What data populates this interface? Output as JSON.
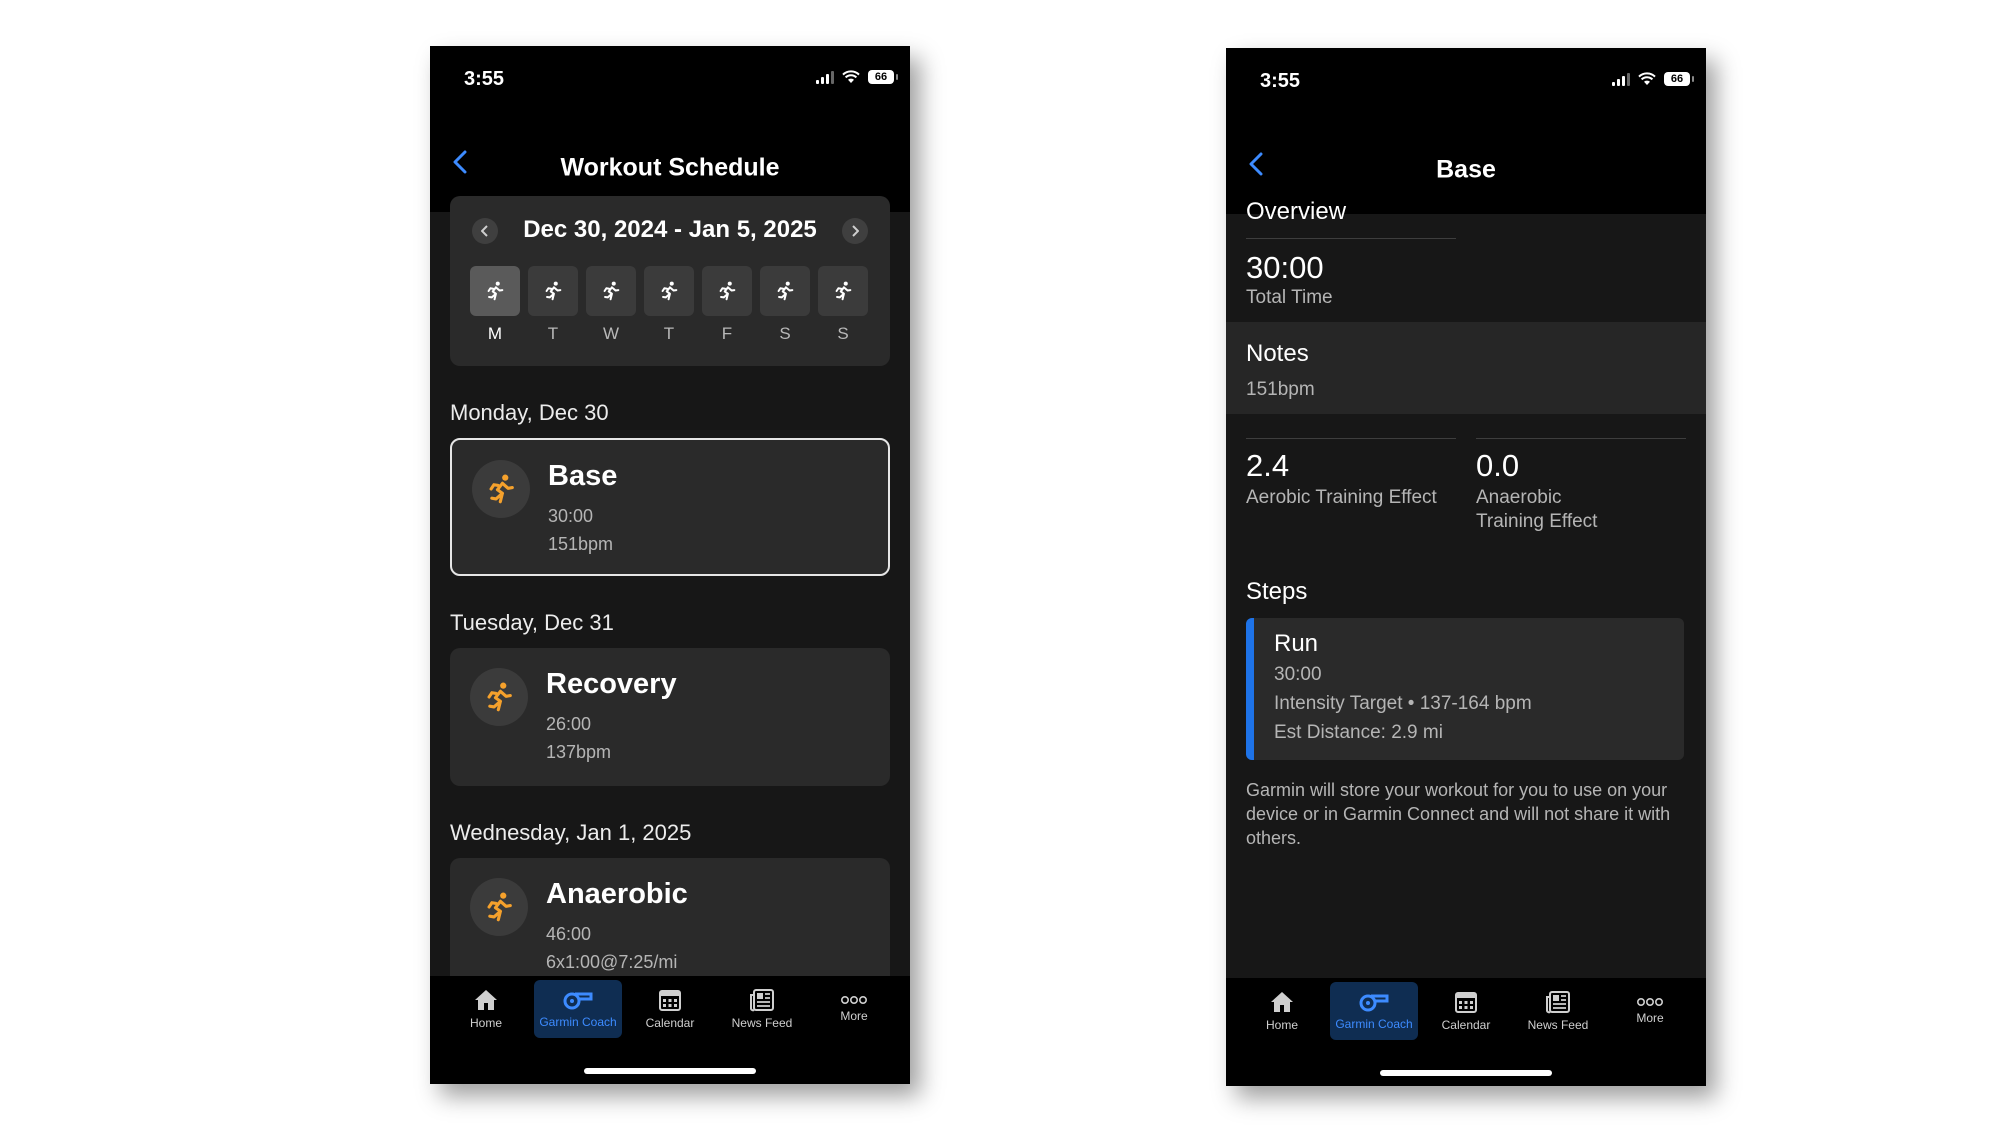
{
  "left_phone": {
    "status": {
      "time": "3:55",
      "battery": "66"
    },
    "title": "Workout Schedule",
    "week": {
      "range": "Dec 30, 2024 - Jan 5, 2025",
      "days": [
        "M",
        "T",
        "W",
        "T",
        "F",
        "S",
        "S"
      ],
      "selected_day": "M"
    },
    "schedule": [
      {
        "heading": "Monday, Dec 30",
        "name": "Base",
        "duration": "30:00",
        "target": "151bpm",
        "selected": true
      },
      {
        "heading": "Tuesday, Dec 31",
        "name": "Recovery",
        "duration": "26:00",
        "target": "137bpm",
        "selected": false
      },
      {
        "heading": "Wednesday, Jan 1, 2025",
        "name": "Anaerobic",
        "duration": "46:00",
        "target": "6x1:00@7:25/mi",
        "selected": false
      }
    ],
    "tabs": [
      {
        "label": "Home",
        "icon": "home-icon",
        "active": false
      },
      {
        "label": "Garmin Coach",
        "icon": "whistle-icon",
        "active": true
      },
      {
        "label": "Calendar",
        "icon": "calendar-icon",
        "active": false
      },
      {
        "label": "News Feed",
        "icon": "news-feed-icon",
        "active": false
      },
      {
        "label": "More",
        "icon": "more-icon",
        "active": false
      }
    ]
  },
  "right_phone": {
    "status": {
      "time": "3:55",
      "battery": "66"
    },
    "title": "Base",
    "overview": {
      "heading": "Overview",
      "total_time": "30:00",
      "total_time_label": "Total Time"
    },
    "notes": {
      "heading": "Notes",
      "text": "151bpm"
    },
    "training_effect": {
      "aerobic_value": "2.4",
      "aerobic_label": "Aerobic Training Effect",
      "anaerobic_value": "0.0",
      "anaerobic_label_1": "Anaerobic",
      "anaerobic_label_2": "Training Effect"
    },
    "steps": {
      "heading": "Steps",
      "name": "Run",
      "duration": "30:00",
      "intensity": "Intensity Target • 137-164 bpm",
      "distance": "Est Distance: 2.9 mi"
    },
    "disclaimer": "Garmin will store your workout for you to use on your device or in Garmin Connect and will not share it with others.",
    "tabs": [
      {
        "label": "Home",
        "icon": "home-icon",
        "active": false
      },
      {
        "label": "Garmin Coach",
        "icon": "whistle-icon",
        "active": true
      },
      {
        "label": "Calendar",
        "icon": "calendar-icon",
        "active": false
      },
      {
        "label": "News Feed",
        "icon": "news-feed-icon",
        "active": false
      },
      {
        "label": "More",
        "icon": "more-icon",
        "active": false
      }
    ]
  },
  "colors": {
    "background": "#171717",
    "bar": "#000000",
    "card": "#2a2a2a",
    "accent_orange": "#f5a12c",
    "accent_blue": "#3d8bff",
    "step_bar": "#1e73e8"
  }
}
